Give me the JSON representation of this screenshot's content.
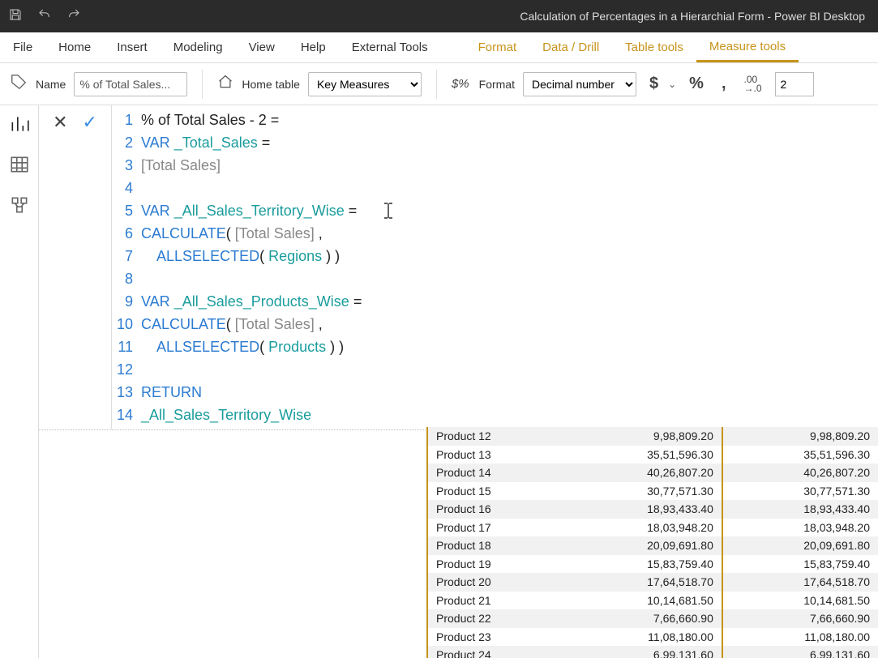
{
  "titlebar": {
    "title": "Calculation of Percentages in a Hierarchial Form - Power BI Desktop"
  },
  "tabs": {
    "file": "File",
    "home": "Home",
    "insert": "Insert",
    "modeling": "Modeling",
    "view": "View",
    "help": "Help",
    "external": "External Tools",
    "format": "Format",
    "datadrill": "Data / Drill",
    "tabletools": "Table tools",
    "measuretools": "Measure tools"
  },
  "ribbon": {
    "name_label": "Name",
    "name_value": "% of Total Sales...",
    "hometable_label": "Home table",
    "hometable_value": "Key Measures",
    "format_label": "Format",
    "format_value": "Decimal number",
    "currency": "$",
    "percent": "%",
    "comma": ",",
    "decimals_value": "2"
  },
  "formula": {
    "lines": [
      {
        "n": "1",
        "segs": [
          [
            "plain",
            "% of Total Sales - 2 ="
          ]
        ]
      },
      {
        "n": "2",
        "segs": [
          [
            "kw",
            "VAR"
          ],
          [
            "plain",
            " "
          ],
          [
            "ident",
            "_Total_Sales"
          ],
          [
            "plain",
            " ="
          ]
        ]
      },
      {
        "n": "3",
        "segs": [
          [
            "measure",
            "[Total Sales]"
          ]
        ]
      },
      {
        "n": "4",
        "segs": [
          [
            "plain",
            ""
          ]
        ]
      },
      {
        "n": "5",
        "segs": [
          [
            "kw",
            "VAR"
          ],
          [
            "plain",
            " "
          ],
          [
            "ident",
            "_All_Sales_Territory_Wise"
          ],
          [
            "plain",
            " ="
          ]
        ]
      },
      {
        "n": "6",
        "segs": [
          [
            "func",
            "CALCULATE"
          ],
          [
            "plain",
            "( "
          ],
          [
            "measure",
            "[Total Sales]"
          ],
          [
            "plain",
            " ,"
          ]
        ]
      },
      {
        "n": "7",
        "segs": [
          [
            "plain",
            "    "
          ],
          [
            "func",
            "ALLSELECTED"
          ],
          [
            "plain",
            "( "
          ],
          [
            "tbl",
            "Regions"
          ],
          [
            "plain",
            " ) )"
          ]
        ]
      },
      {
        "n": "8",
        "segs": [
          [
            "plain",
            ""
          ]
        ]
      },
      {
        "n": "9",
        "segs": [
          [
            "kw",
            "VAR"
          ],
          [
            "plain",
            " "
          ],
          [
            "ident",
            "_All_Sales_Products_Wise"
          ],
          [
            "plain",
            " ="
          ]
        ]
      },
      {
        "n": "10",
        "segs": [
          [
            "func",
            "CALCULATE"
          ],
          [
            "plain",
            "( "
          ],
          [
            "measure",
            "[Total Sales]"
          ],
          [
            "plain",
            " ,"
          ]
        ]
      },
      {
        "n": "11",
        "segs": [
          [
            "plain",
            "    "
          ],
          [
            "func",
            "ALLSELECTED"
          ],
          [
            "plain",
            "( "
          ],
          [
            "tbl",
            "Products"
          ],
          [
            "plain",
            " ) )"
          ]
        ]
      },
      {
        "n": "12",
        "segs": [
          [
            "plain",
            ""
          ]
        ]
      },
      {
        "n": "13",
        "segs": [
          [
            "kw",
            "RETURN"
          ]
        ]
      },
      {
        "n": "14",
        "segs": [
          [
            "ident",
            "_All_Sales_Territory_Wise"
          ]
        ]
      }
    ]
  },
  "table": {
    "rows": [
      {
        "p": "Product 12",
        "a": "9,98,809.20",
        "b": "9,98,809.20"
      },
      {
        "p": "Product 13",
        "a": "35,51,596.30",
        "b": "35,51,596.30"
      },
      {
        "p": "Product 14",
        "a": "40,26,807.20",
        "b": "40,26,807.20"
      },
      {
        "p": "Product 15",
        "a": "30,77,571.30",
        "b": "30,77,571.30"
      },
      {
        "p": "Product 16",
        "a": "18,93,433.40",
        "b": "18,93,433.40"
      },
      {
        "p": "Product 17",
        "a": "18,03,948.20",
        "b": "18,03,948.20"
      },
      {
        "p": "Product 18",
        "a": "20,09,691.80",
        "b": "20,09,691.80"
      },
      {
        "p": "Product 19",
        "a": "15,83,759.40",
        "b": "15,83,759.40"
      },
      {
        "p": "Product 20",
        "a": "17,64,518.70",
        "b": "17,64,518.70"
      },
      {
        "p": "Product 21",
        "a": "10,14,681.50",
        "b": "10,14,681.50"
      },
      {
        "p": "Product 22",
        "a": "7,66,660.90",
        "b": "7,66,660.90"
      },
      {
        "p": "Product 23",
        "a": "11,08,180.00",
        "b": "11,08,180.00"
      },
      {
        "p": "Product 24",
        "a": "6,99,131.60",
        "b": "6,99,131.60"
      }
    ]
  }
}
